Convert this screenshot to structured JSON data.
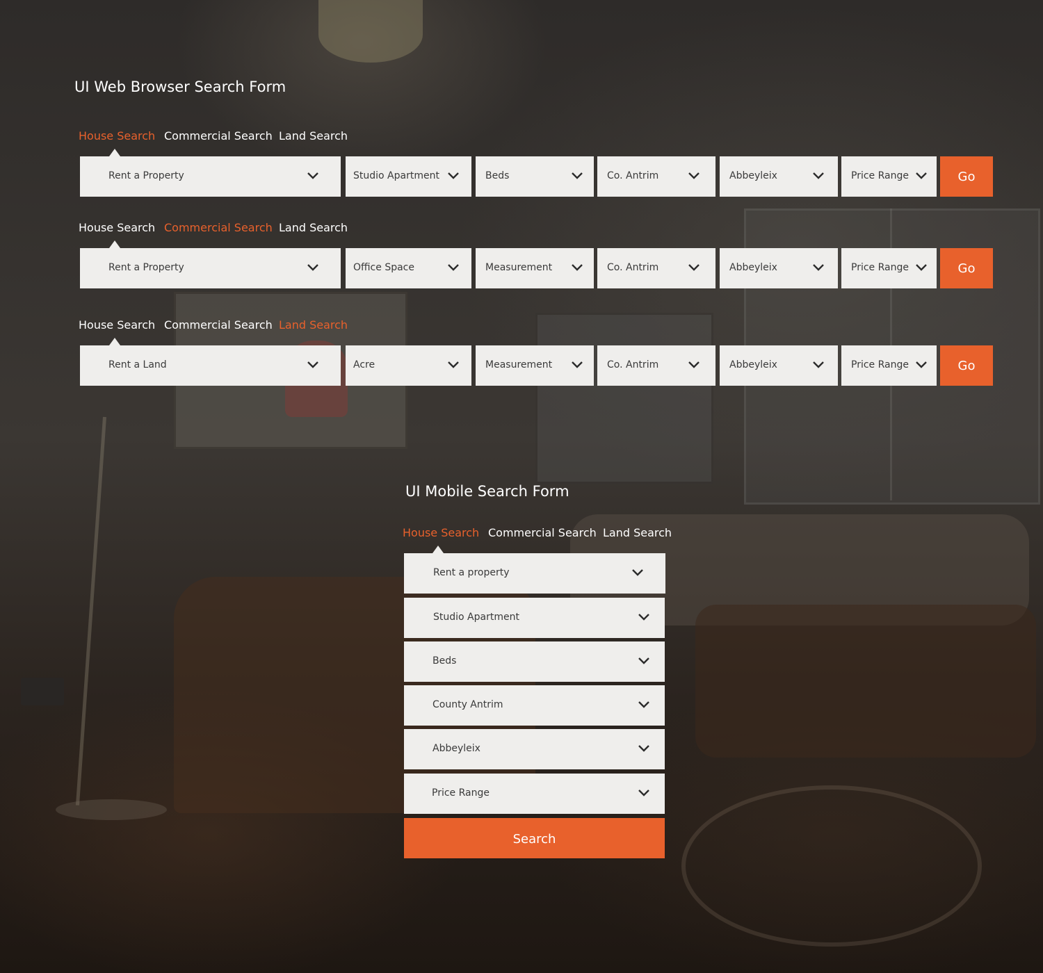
{
  "web_form": {
    "title": "UI Web Browser Search Form",
    "rows": [
      {
        "tabs": [
          "House Search",
          "Commercial Search",
          "Land Search"
        ],
        "active_tab": 0,
        "fields": [
          "Rent a Property",
          "Studio Apartment",
          "Beds",
          "Co. Antrim",
          "Abbeyleix",
          "Price Range"
        ],
        "button": "Go"
      },
      {
        "tabs": [
          "House Search",
          "Commercial Search",
          "Land Search"
        ],
        "active_tab": 1,
        "fields": [
          "Rent a Property",
          "Office Space",
          "Measurement",
          "Co. Antrim",
          "Abbeyleix",
          "Price Range"
        ],
        "button": "Go"
      },
      {
        "tabs": [
          "House Search",
          "Commercial Search",
          "Land Search"
        ],
        "active_tab": 2,
        "fields": [
          "Rent a Land",
          "Acre",
          "Measurement",
          "Co. Antrim",
          "Abbeyleix",
          "Price Range"
        ],
        "button": "Go"
      }
    ]
  },
  "mobile_form": {
    "title": "UI Mobile Search Form",
    "tabs": [
      "House Search",
      "Commercial Search",
      "Land Search"
    ],
    "active_tab": 0,
    "fields": [
      "Rent a property",
      "Studio Apartment",
      "Beds",
      "County Antrim",
      "Abbeyleix",
      "Price Range"
    ],
    "button": "Search"
  },
  "colors": {
    "accent": "#e8612c",
    "field_bg": "#efeeec",
    "field_text": "#3a3a3a",
    "text": "#ffffff"
  },
  "icons": {
    "dropdown": "chevron-down-icon",
    "tab_pointer": "triangle-up-icon"
  }
}
